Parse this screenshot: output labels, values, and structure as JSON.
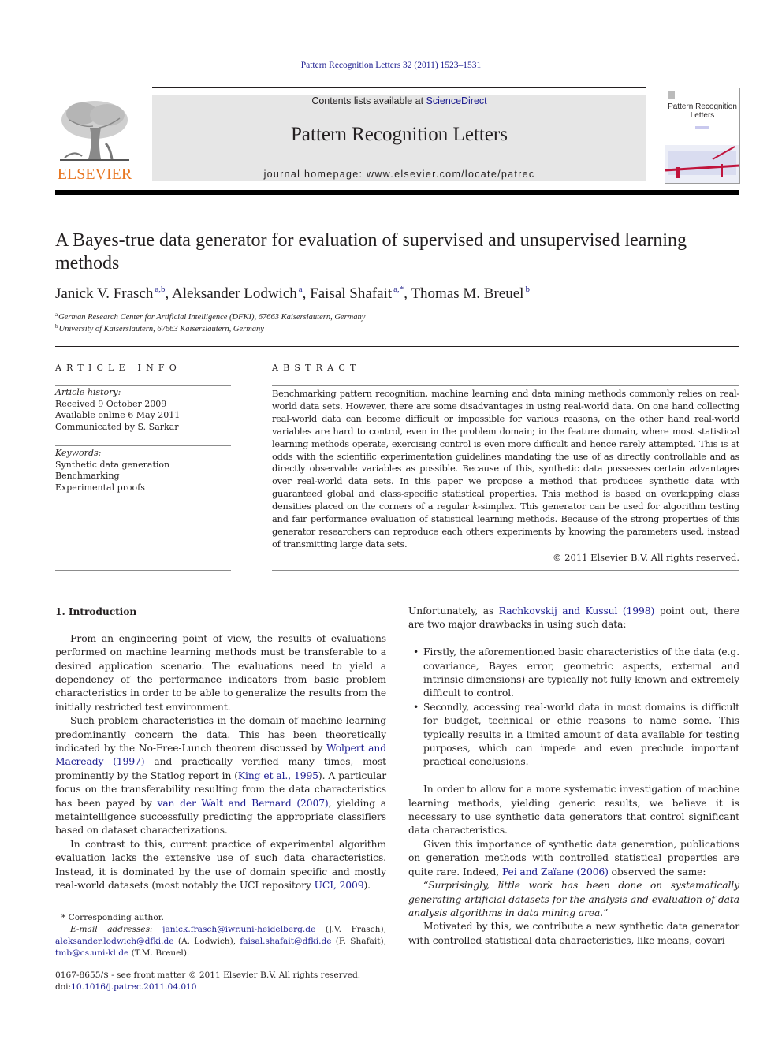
{
  "header": {
    "citation": "Pattern Recognition Letters 32 (2011) 1523–1531",
    "contents_prefix": "Contents lists available at ",
    "contents_link": "ScienceDirect",
    "journal_title": "Pattern Recognition Letters",
    "homepage_prefix": "journal homepage: ",
    "homepage_url": "www.elsevier.com/locate/patrec",
    "publisher_logo_text": "ELSEVIER",
    "cover_title": "Pattern Recognition Letters",
    "colors": {
      "elsevier_orange": "#e87722",
      "link_blue": "#1b1b8f",
      "banner_gray": "#e6e6e6"
    }
  },
  "article": {
    "title": "A Bayes-true data generator for evaluation of supervised and unsupervised learning methods",
    "authors": [
      {
        "name": "Janick V. Frasch",
        "sup": "a,b"
      },
      {
        "name": "Aleksander Lodwich",
        "sup": "a"
      },
      {
        "name": "Faisal Shafait",
        "sup": "a,*"
      },
      {
        "name": "Thomas M. Breuel",
        "sup": "b"
      }
    ],
    "affiliations": [
      {
        "mark": "a",
        "text": "German Research Center for Artificial Intelligence (DFKI), 67663 Kaiserslautern, Germany"
      },
      {
        "mark": "b",
        "text": "University of Kaiserslautern, 67663 Kaiserslautern, Germany"
      }
    ]
  },
  "article_info": {
    "heading": "ARTICLE INFO",
    "history_label": "Article history:",
    "history": [
      "Received 9 October 2009",
      "Available online 6 May 2011",
      "Communicated by S. Sarkar"
    ],
    "keywords_label": "Keywords:",
    "keywords": [
      "Synthetic data generation",
      "Benchmarking",
      "Experimental proofs"
    ]
  },
  "abstract": {
    "heading": "ABSTRACT",
    "text_before_k": "Benchmarking pattern recognition, machine learning and data mining methods commonly relies on real-world data sets. However, there are some disadvantages in using real-world data. On one hand collecting real-world data can become difficult or impossible for various reasons, on the other hand real-world variables are hard to control, even in the problem domain; in the feature domain, where most statistical learning methods operate, exercising control is even more difficult and hence rarely attempted. This is at odds with the scientific experimentation guidelines mandating the use of as directly controllable and as directly observable variables as possible. Because of this, synthetic data possesses certain advantages over real-world data sets. In this paper we propose a method that produces synthetic data with guaranteed global and class-specific statistical properties. This method is based on overlapping class densities placed on the corners of a regular ",
    "k": "k",
    "text_after_k": "-simplex. This generator can be used for algorithm testing and fair performance evaluation of statistical learning methods. Because of the strong properties of this generator researchers can reproduce each others experiments by knowing the parameters used, instead of transmitting large data sets.",
    "copyright": "© 2011 Elsevier B.V. All rights reserved."
  },
  "body": {
    "section_title": "1. Introduction",
    "p1": "From an engineering point of view, the results of evaluations performed on machine learning methods must be transferable to a desired application scenario. The evaluations need to yield a dependency of the performance indicators from basic problem characteristics in order to be able to generalize the results from the initially restricted test environment.",
    "p2_a": "Such problem characteristics in the domain of machine learning predominantly concern the data. This has been theoretically indicated by the No-Free-Lunch theorem discussed by ",
    "p2_link1": "Wolpert and Macready (1997)",
    "p2_b": " and practically verified many times, most prominently by the Statlog report in (",
    "p2_link2": "King et al., 1995",
    "p2_c": "). A particular focus on the transferability resulting from the data characteristics has been payed by ",
    "p2_link3": "van der Walt and Bernard (2007)",
    "p2_d": ", yielding a metaintelligence successfully predicting the appropriate classifiers based on dataset characterizations.",
    "p3_a": "In contrast to this, current practice of experimental algorithm evaluation lacks the extensive use of such data characteristics. Instead, it is dominated by the use of domain specific and mostly real-world datasets (most notably the UCI repository ",
    "p3_link": "UCI, 2009",
    "p3_b": ").",
    "r1_a": "Unfortunately, as ",
    "r1_link": "Rachkovskij and Kussul (1998)",
    "r1_b": " point out, there are two major drawbacks in using such data:",
    "bullets": [
      "Firstly, the aforementioned basic characteristics of the data (e.g. covariance, Bayes error, geometric aspects, external and intrinsic dimensions) are typically not fully known and extremely difficult to control.",
      "Secondly, accessing real-world data in most domains is difficult for budget, technical or ethic reasons to name some. This typically results in a limited amount of data available for testing purposes, which can impede and even preclude important practical conclusions."
    ],
    "r2": "In order to allow for a more systematic investigation of machine learning methods, yielding generic results, we believe it is necessary to use synthetic data generators that control significant data characteristics.",
    "r3_a": "Given this importance of synthetic data generation, publications on generation methods with controlled statistical properties are quite rare. Indeed, ",
    "r3_link": "Pei and Zaïane (2006)",
    "r3_b": " observed the same:",
    "r4_quote": "“Surprisingly, little work has been done on systematically generating artificial datasets for the analysis and evaluation of data analysis algorithms in data mining area.”",
    "r5": "Motivated by this, we contribute a new synthetic data generator with controlled statistical data characteristics, like means, covari-"
  },
  "footnotes": {
    "corresponding": "* Corresponding author.",
    "email_label": "E-mail addresses: ",
    "emails": [
      {
        "address": "janick.frasch@iwr.uni-heidelberg.de",
        "who": " (J.V. Frasch), "
      },
      {
        "address": "aleksander.lodwich@dfki.de",
        "who": " (A. Lodwich), "
      },
      {
        "address": "faisal.shafait@dfki.de",
        "who": " (F. Shafait), "
      },
      {
        "address": "tmb@cs.uni-kl.de",
        "who": " (T.M. Breuel)."
      }
    ],
    "issn_line": "0167-8655/$ - see front matter © 2011 Elsevier B.V. All rights reserved.",
    "doi_prefix": "doi:",
    "doi": "10.1016/j.patrec.2011.04.010"
  }
}
